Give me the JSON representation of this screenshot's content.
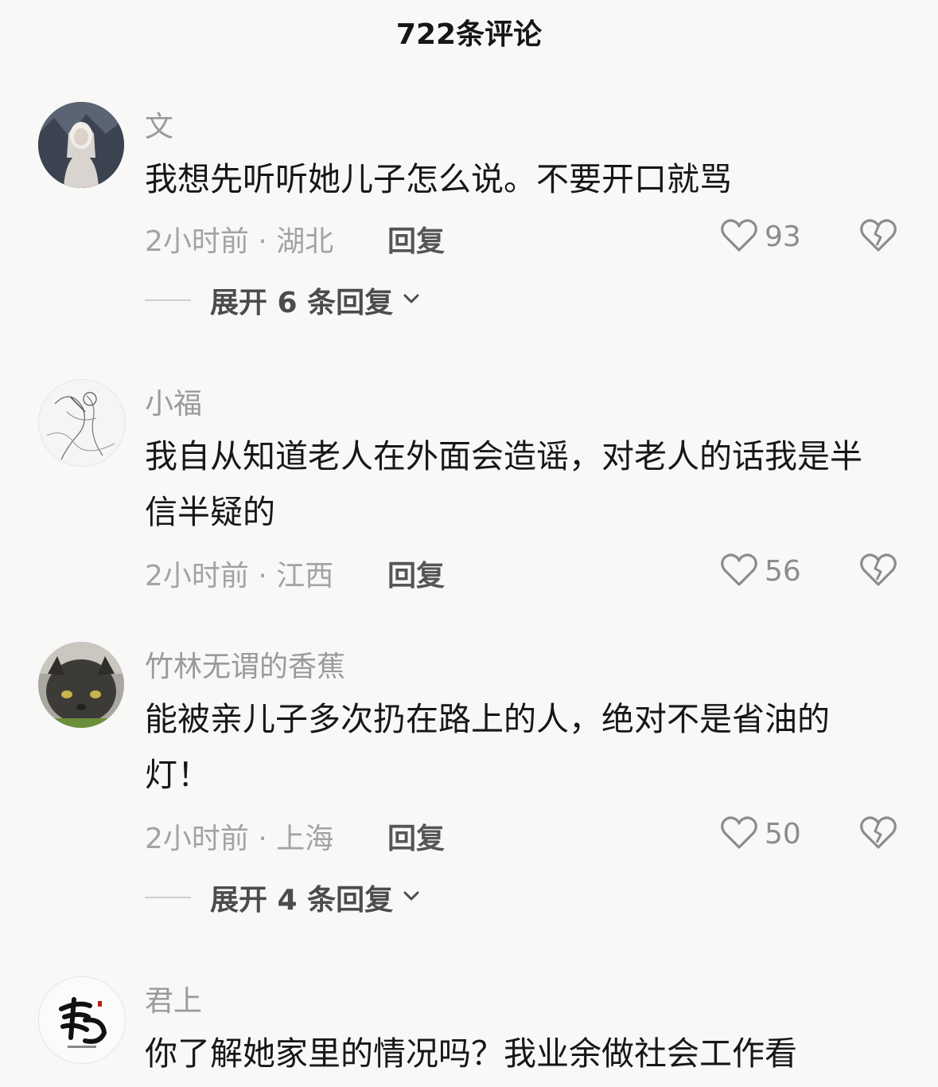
{
  "header": {
    "title": "722条评论"
  },
  "comments": [
    {
      "username": "文",
      "text": "我想先听听她儿子怎么说。不要开口就骂",
      "time": "2小时前",
      "location": "湖北",
      "meta": "2小时前 · 湖北",
      "reply_label": "回复",
      "likes": "93",
      "expand_label": "展开 6 条回复"
    },
    {
      "username": "小福",
      "text": "我自从知道老人在外面会造谣，对老人的话我是半信半疑的",
      "time": "2小时前",
      "location": "江西",
      "meta": "2小时前 · 江西",
      "reply_label": "回复",
      "likes": "56"
    },
    {
      "username": "竹林无谓的香蕉",
      "text": "能被亲儿子多次扔在路上的人，绝对不是省油的灯！",
      "time": "2小时前",
      "location": "上海",
      "meta": "2小时前 · 上海",
      "reply_label": "回复",
      "likes": "50",
      "expand_label": "展开 4 条回复"
    },
    {
      "username": "君上",
      "text": "你了解她家里的情况吗？我业余做社会工作看"
    }
  ],
  "icons": {
    "like": "heart-outline-icon",
    "dislike": "broken-heart-icon",
    "expand": "chevron-down-icon"
  }
}
